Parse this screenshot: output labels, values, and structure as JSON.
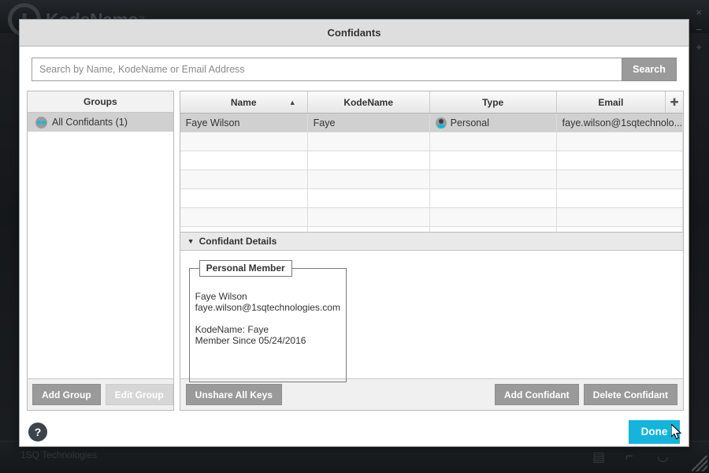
{
  "background_app": {
    "logo_text": "KodeName",
    "logo_tm": "™",
    "company": "1SQ Technologies",
    "window_controls": {
      "close": "×",
      "minimize": "−",
      "maximize": "+"
    },
    "status_icons": [
      "message-icon",
      "key-icon",
      "shield-icon"
    ]
  },
  "dialog": {
    "title": "Confidants",
    "search": {
      "placeholder": "Search by Name, KodeName or Email Address",
      "value": "",
      "button_label": "Search"
    },
    "groups_pane": {
      "header": "Groups",
      "items": [
        {
          "label": "All Confidants (1)",
          "selected": true,
          "icon": "group-icon"
        }
      ],
      "add_group_label": "Add Group",
      "edit_group_label": "Edit Group",
      "edit_group_disabled": true
    },
    "table": {
      "columns": [
        {
          "label": "Name",
          "sorted": true,
          "sort_arrow": "▲"
        },
        {
          "label": "KodeName",
          "sorted": false,
          "sort_arrow": ""
        },
        {
          "label": "Type",
          "sorted": false,
          "sort_arrow": ""
        },
        {
          "label": "Email",
          "sorted": false,
          "sort_arrow": ""
        }
      ],
      "add_column_icon": "plus-icon",
      "rows": [
        {
          "name": "Faye Wilson",
          "kodename": "Faye",
          "type": "Personal",
          "type_icon": "person-icon",
          "email": "faye.wilson@1sqtechnolo...",
          "selected": true
        }
      ],
      "empty_row_count": 6
    },
    "details": {
      "caret": "▼",
      "title": "Confidant Details",
      "card": {
        "legend": "Personal Member",
        "name": "Faye Wilson",
        "email": "faye.wilson@1sqtechnologies.com",
        "kodename_line": "KodeName: Faye",
        "member_since_line": "Member Since 05/24/2016"
      }
    },
    "actions": {
      "unshare_all_keys": "Unshare All Keys",
      "add_confidant": "Add Confidant",
      "delete_confidant": "Delete Confidant"
    },
    "footer": {
      "help_label": "?",
      "done_label": "Done"
    }
  },
  "colors": {
    "accent": "#14b4dc",
    "button_gray": "#9a9a9a",
    "button_disabled": "#d6d6d6",
    "dialog_titlebar": "#dedede",
    "selected_row": "#d0d0d0",
    "dark_chrome": "#15181b"
  }
}
